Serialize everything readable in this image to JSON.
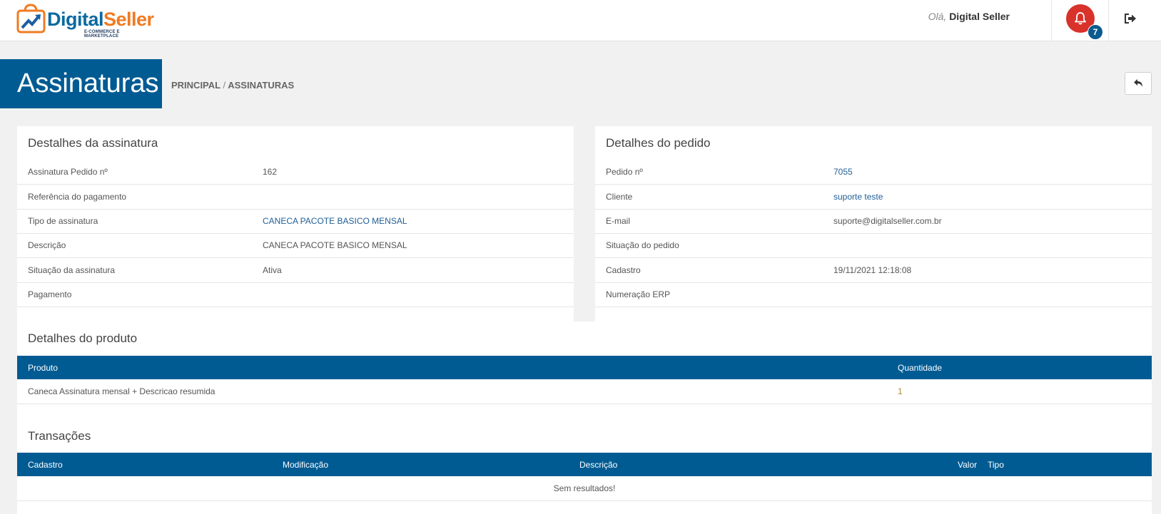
{
  "header": {
    "logo_text_a": "Digital",
    "logo_text_b": "Seller",
    "logo_tagline": "E-COMMERCE E MARKETPLACE",
    "greeting_prefix": "Olá,",
    "user_name": "Digital Seller",
    "notification_count": "7"
  },
  "page": {
    "title": "Assinaturas",
    "breadcrumb_root": "PRINCIPAL",
    "breadcrumb_sep": "/",
    "breadcrumb_current": "ASSINATURAS"
  },
  "subscription": {
    "title": "Destalhes da assinatura",
    "rows": [
      {
        "label": "Assinatura Pedido nº",
        "value": "162"
      },
      {
        "label": "Referência do pagamento",
        "value": ""
      },
      {
        "label": "Tipo de assinatura",
        "value": "CANECA PACOTE BASICO MENSAL"
      },
      {
        "label": "Descrição",
        "value": "CANECA PACOTE BASICO MENSAL"
      },
      {
        "label": "Situação da assinatura",
        "value": "Ativa"
      },
      {
        "label": "Pagamento",
        "value": ""
      }
    ]
  },
  "order": {
    "title": "Detalhes do pedido",
    "rows": [
      {
        "label": "Pedido nº",
        "value": "7055"
      },
      {
        "label": "Cliente",
        "value": "suporte teste"
      },
      {
        "label": "E-mail",
        "value": "suporte@digitalseller.com.br"
      },
      {
        "label": "Situação do pedido",
        "value": ""
      },
      {
        "label": "Cadastro",
        "value": "19/11/2021 12:18:08"
      },
      {
        "label": "Numeração ERP",
        "value": ""
      }
    ]
  },
  "product": {
    "title": "Detalhes do produto",
    "headers": {
      "product": "Produto",
      "quantity": "Quantidade"
    },
    "rows": [
      {
        "product": "Caneca Assinatura mensal + Descricao resumida",
        "quantity": "1"
      }
    ]
  },
  "transactions": {
    "title": "Transações",
    "headers": {
      "created": "Cadastro",
      "modified": "Modificação",
      "description": "Descrição",
      "value": "Valor",
      "type": "Tipo"
    },
    "empty_text": "Sem resultados!"
  },
  "colors": {
    "primary": "#005b93",
    "bell": "#d8322b",
    "link": "#1f5f96",
    "brand_orange": "#f07b22"
  }
}
